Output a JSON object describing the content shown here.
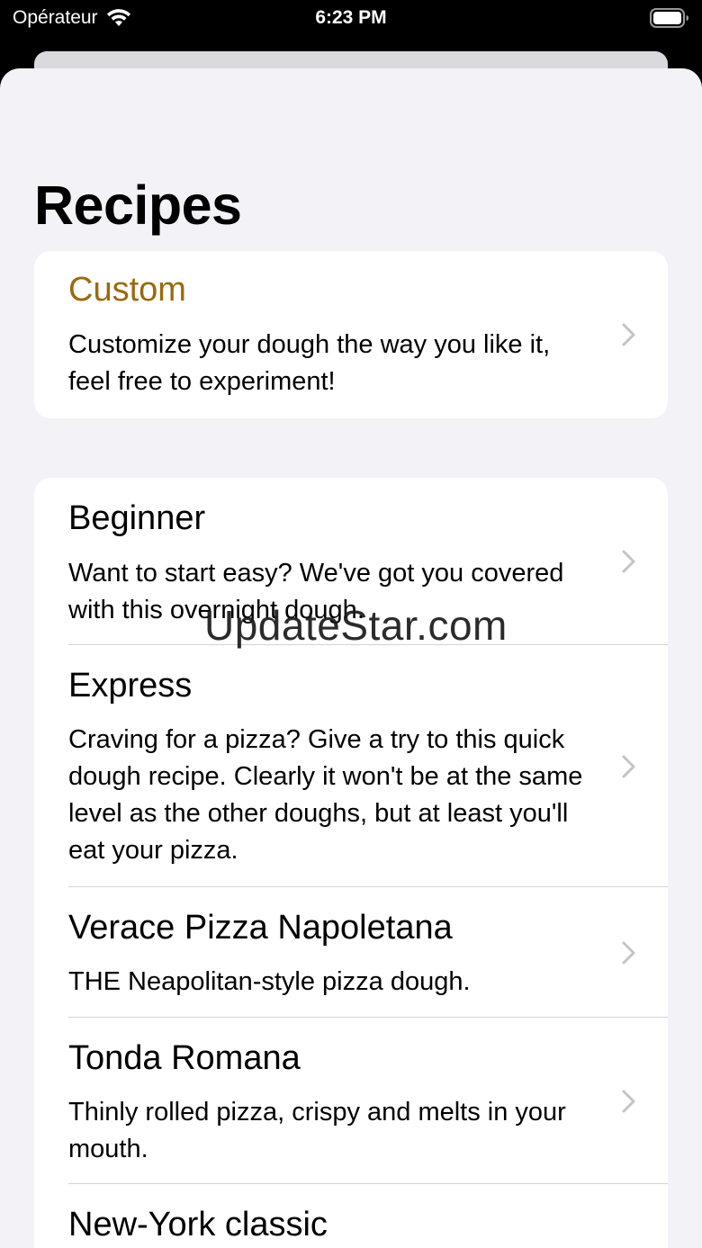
{
  "status": {
    "carrier": "Opérateur",
    "time": "6:23 PM"
  },
  "page": {
    "title": "Recipes"
  },
  "custom": {
    "title": "Custom",
    "description": "Customize your dough the way you like it, feel free to experiment!",
    "accent_color": "#9a6a0e"
  },
  "recipes": [
    {
      "title": "Beginner",
      "description": "Want to start easy? We've got you covered with this overnight dough."
    },
    {
      "title": "Express",
      "description": "Craving for a pizza? Give a try to this quick dough recipe. Clearly it won't be at the same level as the other doughs, but at least you'll eat your pizza."
    },
    {
      "title": "Verace Pizza Napoletana",
      "description": "THE Neapolitan-style pizza dough."
    },
    {
      "title": "Tonda Romana",
      "description": "Thinly rolled pizza, crispy and melts in your mouth."
    },
    {
      "title": "New-York classic",
      "description": ""
    }
  ],
  "watermark": "UpdateStar.com"
}
